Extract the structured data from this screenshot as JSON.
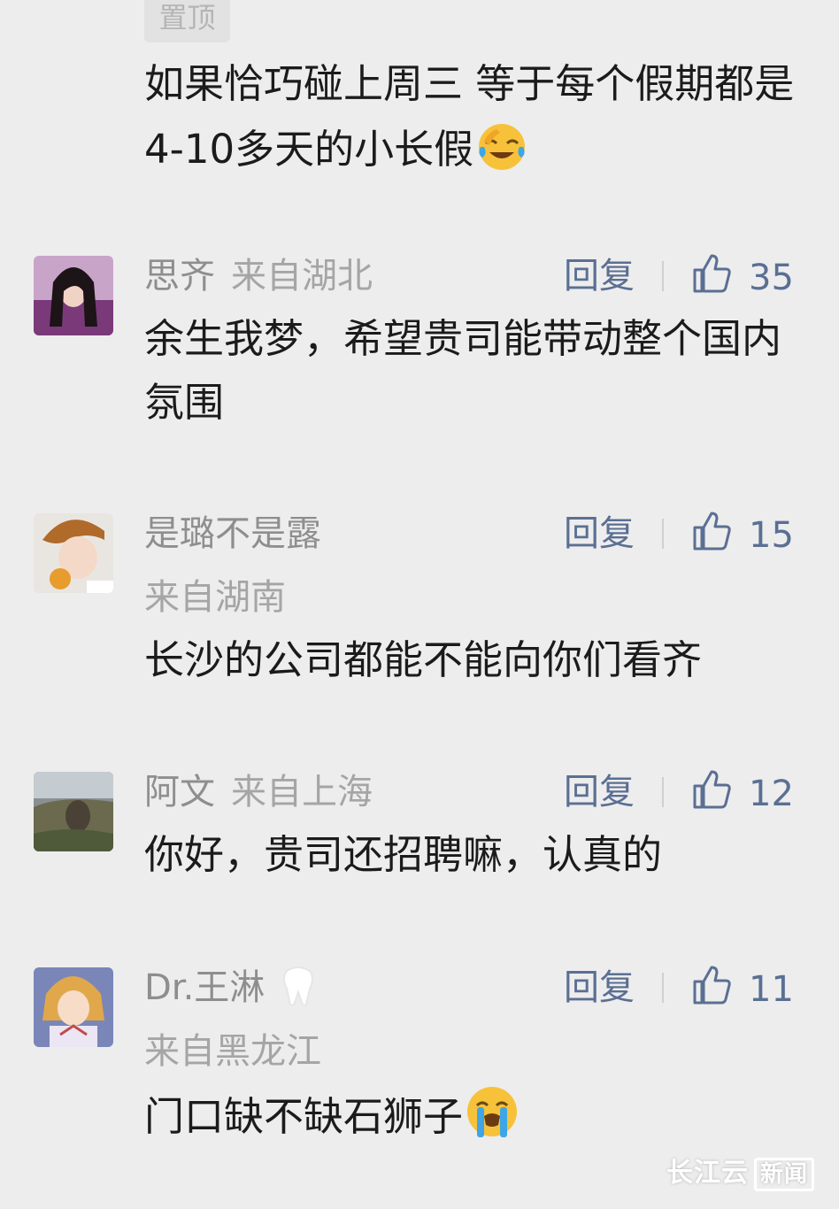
{
  "pinned": {
    "badge": "置顶",
    "text": "如果恰巧碰上周三 等于每个假期都是4-10多天的小长假"
  },
  "reply_label": "回复",
  "comments": [
    {
      "name": "思齐",
      "location": "来自湖北",
      "likes": "35",
      "text": "余生我梦，希望贵司能带动整个国内氛围"
    },
    {
      "name": "是璐不是露",
      "location": "来自湖南",
      "likes": "15",
      "text": "长沙的公司都能不能向你们看齐"
    },
    {
      "name": "阿文",
      "location": "来自上海",
      "likes": "12",
      "text": "你好，贵司还招聘嘛，认真的"
    },
    {
      "name": "Dr.王淋",
      "location": "来自黑龙江",
      "likes": "11",
      "text": "门口缺不缺石狮子"
    }
  ],
  "icons": {
    "like": "thumbs-up-icon",
    "emoji_laugh_cry": "face-with-tears-of-joy-icon",
    "emoji_crying": "loudly-crying-face-icon",
    "name_badge": "tooth-icon"
  },
  "colors": {
    "background": "#ededed",
    "accent_link": "#5a6f93",
    "meta_text": "#9a9a9a",
    "body_text": "#1b1b1b"
  },
  "watermark": {
    "brand": "长江云",
    "tag": "新闻"
  }
}
